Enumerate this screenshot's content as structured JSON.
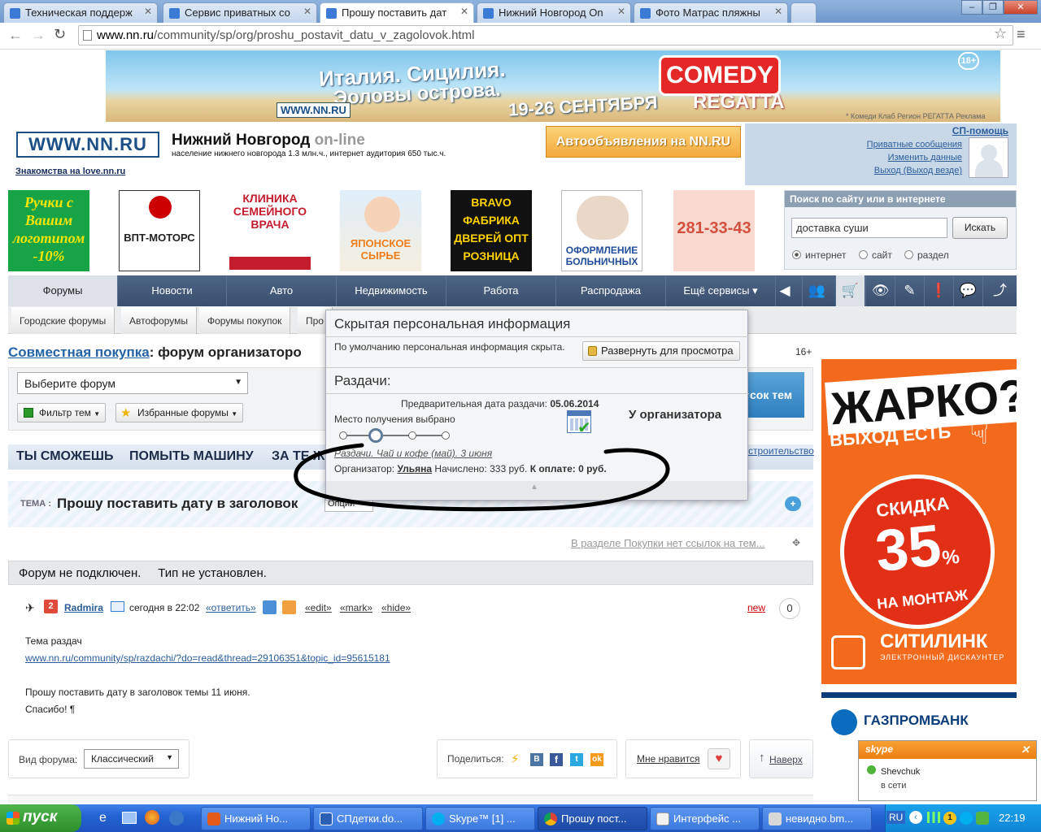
{
  "browser": {
    "tabs": [
      {
        "label": "Техническая поддерж",
        "color": "#4a90d9"
      },
      {
        "label": "Сервис приватных со",
        "color": "#4a90d9"
      },
      {
        "label": "Прошу поставить дат",
        "color": "#4a90d9"
      },
      {
        "label": "Нижний Новгород On",
        "color": "#4a90d9"
      },
      {
        "label": "Фото Матрас пляжны",
        "color": "#4a90d9"
      }
    ],
    "url_host": "www.nn.ru",
    "url_path": "/community/sp/org/proshu_postavit_datu_v_zagolovok.html"
  },
  "banner": {
    "line1": "Италия. Сицилия.",
    "line2": "Эоловы острова.",
    "dates": "19-26 СЕНТЯБРЯ",
    "brand": "COMEDY",
    "brand_sub": "REGATTA",
    "age": "18+",
    "logo": "WWW.NN.RU",
    "note": "* Комеди Клаб Регион РЕГАТТА    Реклама"
  },
  "header": {
    "logo": "WWW.NN.RU",
    "dating": "Знакомства на love.nn.ru",
    "city": "Нижний Новгород",
    "online": "on-line",
    "population": "население нижнего новгорода 1.3 млн.ч., интернет аудитория 650 тыс.ч.",
    "autoads": "Автообъявления на NN.RU"
  },
  "userbox": {
    "sp_help": "СП-помощь",
    "links": [
      "Приватные сообщения",
      "Изменить данные",
      "Выход (Выход везде)"
    ]
  },
  "ads": [
    {
      "text": "Ручки с Вашим логотипом -10%"
    },
    {
      "text": "ВПТ-МОТОРС"
    },
    {
      "text": "КЛИНИКА СЕМЕЙНОГО ВРАЧА"
    },
    {
      "text": "ЯПОНСКОЕ СЫРЬЕ"
    },
    {
      "text": "BRAVO ФАБРИКА ДВЕРЕЙ ОПТ РОЗНИЦА"
    },
    {
      "text": "ОФОРМЛЕНИЕ БОЛЬНИЧНЫХ"
    },
    {
      "text": "281-33-43"
    }
  ],
  "search": {
    "title": "Поиск по сайту или в интернете",
    "value": "доставка суши",
    "button": "Искать",
    "options": [
      "интернет",
      "сайт",
      "раздел"
    ]
  },
  "nav": {
    "items": [
      "Форумы",
      "Новости",
      "Авто",
      "Недвижимость",
      "Работа",
      "Распродажа",
      "Ещё сервисы ▾"
    ],
    "sub": [
      "Городские форумы",
      "Автофорумы",
      "Форумы покупок",
      "Про"
    ]
  },
  "page": {
    "title_link": "Совместная покупка",
    "title_rest": ": форум организаторо",
    "age": "16+",
    "forum_select": "Выберите форум",
    "filter_btn": "Фильтр тем",
    "fav_btn": "Избранные форумы",
    "themes_btn": "сок тем",
    "promo": [
      "ТЫ СМОЖЕШЬ",
      "ПОМЫТЬ МАШИНУ",
      "ЗА ТЕ Ж"
    ],
    "promo_link": "строительство",
    "topic_label": "ТЕМА :",
    "topic_title": "Прошу поставить дату в заголовок",
    "options": "Опции",
    "nolinks": "В разделе Покупки нет ссылок на тем...",
    "status": "Форум не подключен.     Тип не установлен."
  },
  "post": {
    "author": "Radmira",
    "time": "сегодня в 22:02",
    "reply": "«ответить»",
    "edit": "«edit»",
    "mark": "«mark»",
    "hide": "«hide»",
    "new": "new",
    "count": "0",
    "lines": [
      "Тема раздач",
      "www.nn.ru/community/sp/razdachi/?do=read&thread=29106351&topic_id=95615181",
      "",
      "Прошу поставить дату в заголовок темы 11 июня.",
      "Спасибо! ¶"
    ]
  },
  "footer": {
    "view_label": "Вид форума:",
    "view_value": "Классический",
    "share": "Поделиться:",
    "like": "Мне нравится",
    "top": "Наверх"
  },
  "popup": {
    "title": "Скрытая персональная информация",
    "hidden_note": "По умолчанию персональная информация скрыта.",
    "expand": "Развернуть для просмотра",
    "section": "Раздачи:",
    "pre_date_label": "Предварительная дата раздачи:",
    "pre_date": "05.06.2014",
    "place": "Место получения выбрано",
    "at_org": "У организатора",
    "item": "Раздачи. Чай и кофе (май). 3 июня",
    "org_label": "Организатор:",
    "org_name": "Ульяна",
    "accrued": "Начислено: 333 руб.",
    "to_pay": "К оплате: 0 руб."
  },
  "right_ad": {
    "hot": "ЖАРКО?",
    "exit": "ВЫХОД ЕСТЬ",
    "discount_word": "СКИДКА",
    "discount": "35",
    "pct": "%",
    "mount": "НА МОНТАЖ",
    "brand": "СИТИЛИНК",
    "brand_sub": "ЭЛЕКТРОННЫЙ ДИСКАУНТЕР",
    "bank": "ГАЗПРОМБАНК"
  },
  "skype": {
    "title": "skype",
    "user": "Shevchuk",
    "status": "в сети"
  },
  "taskbar": {
    "start": "пуск",
    "items": [
      "Нижний Но...",
      "СПдетки.do...",
      "Skype™ [1] ...",
      "Прошу пост...",
      "Интерфейс ...",
      "невидно.bm..."
    ],
    "lang": "RU",
    "clock": "22:19"
  }
}
